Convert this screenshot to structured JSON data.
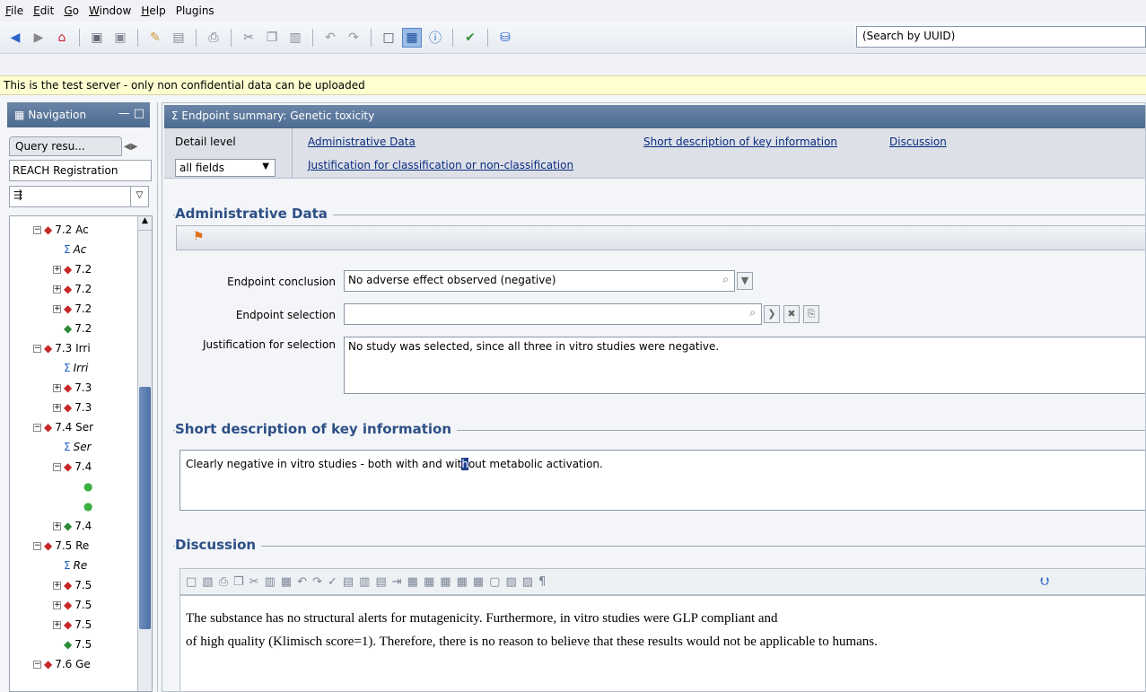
{
  "menu": [
    "File",
    "Edit",
    "Go",
    "Window",
    "Help",
    "Plugins"
  ],
  "menu_mnemonic": [
    "F",
    "E",
    "G",
    "W",
    "H",
    ""
  ],
  "search": {
    "placeholder": "(Search by UUID)"
  },
  "banner": "This is the test server - only non confidential data can be uploaded",
  "nav": {
    "title": "Navigation",
    "tab": "Query resu...",
    "filter": "REACH Registration",
    "tree": [
      {
        "label": "7.2 Ac",
        "italic": false
      },
      {
        "label": "Ac",
        "italic": true
      },
      {
        "label": "7.2",
        "italic": false
      },
      {
        "label": "7.2",
        "italic": false
      },
      {
        "label": "7.2",
        "italic": false
      },
      {
        "label": "7.2",
        "italic": false
      },
      {
        "label": "7.3 Irri",
        "italic": false
      },
      {
        "label": "Irri",
        "italic": true
      },
      {
        "label": "7.3",
        "italic": false
      },
      {
        "label": "7.3",
        "italic": false
      },
      {
        "label": "7.4 Ser",
        "italic": false
      },
      {
        "label": "Ser",
        "italic": true
      },
      {
        "label": "7.4",
        "italic": false
      },
      {
        "label": "",
        "italic": false
      },
      {
        "label": "",
        "italic": false
      },
      {
        "label": "7.4",
        "italic": false
      },
      {
        "label": "7.5 Re",
        "italic": false
      },
      {
        "label": "Re",
        "italic": true
      },
      {
        "label": "7.5",
        "italic": false
      },
      {
        "label": "7.5",
        "italic": false
      },
      {
        "label": "7.5",
        "italic": false
      },
      {
        "label": "7.5",
        "italic": false
      },
      {
        "label": "7.6 Ge",
        "italic": false
      }
    ]
  },
  "main": {
    "title": "Endpoint summary: Genetic toxicity",
    "detail_level_label": "Detail level",
    "detail_level_value": "all fields",
    "links": {
      "administrative": "Administrative Data",
      "justification": "Justification for classification or non-classification",
      "short_desc": "Short description of key information",
      "discussion": "Discussion"
    },
    "admin": {
      "title": "Administrative Data",
      "endpoint_conclusion_label": "Endpoint conclusion",
      "endpoint_conclusion_value": "No adverse effect observed (negative)",
      "endpoint_selection_label": "Endpoint selection",
      "endpoint_selection_value": "",
      "justification_label": "Justification for selection",
      "justification_value": "No study was selected, since all three  in vitro studies were negative."
    },
    "short_desc": {
      "title": "Short description of key information",
      "text_before": "Clearly negative in vitro studies - both with and wit",
      "text_selected": "h",
      "text_after": "out metabolic activation."
    },
    "discussion": {
      "title": "Discussion",
      "line1": "The substance has no structural alerts for mutagenicity. Furthermore, in vitro studies were GLP compliant and",
      "line2": "of high quality (Klimisch score=1). Therefore, there is no reason to believe that these results would not be applicable to humans."
    }
  },
  "colors": {
    "header_blue": "#4c6a90",
    "link_blue": "#0a2a80",
    "section_blue": "#2d4f86",
    "banner_yellow": "#fefed0"
  }
}
